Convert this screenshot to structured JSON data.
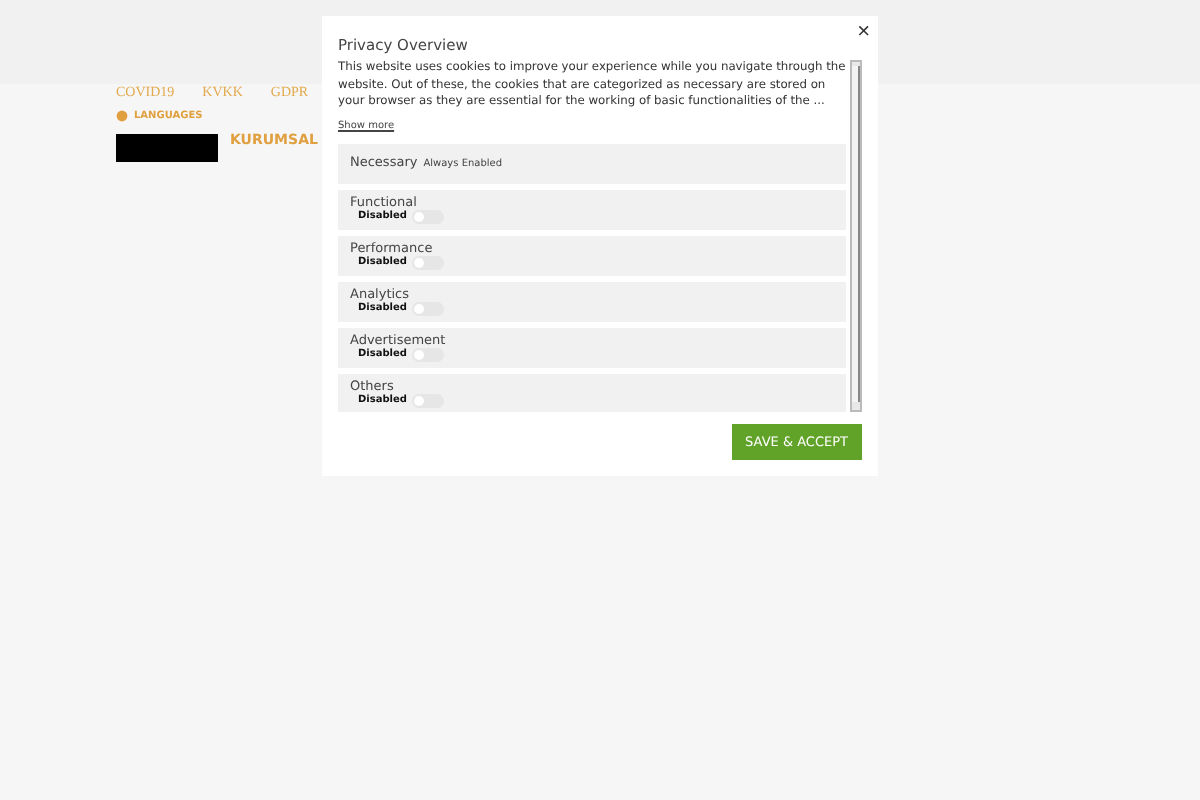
{
  "nav": {
    "links": [
      "COVID19",
      "KVKK",
      "GDPR"
    ],
    "languages": "LANGUAGES",
    "corporate": "KURUMSAL"
  },
  "modal": {
    "title": "Privacy Overview",
    "body": "This website uses cookies to improve your experience while you navigate through the website. Out of these, the cookies that are categorized as necessary are stored on your browser as they are essential for the working of basic functionalities of the ...",
    "show_more": "Show more",
    "close": "×",
    "categories": [
      {
        "kind": "fixed",
        "label": "Necessary",
        "note": "Always Enabled"
      },
      {
        "kind": "toggle",
        "label": "Functional",
        "state_text": "Disabled",
        "on": false
      },
      {
        "kind": "toggle",
        "label": "Performance",
        "state_text": "Disabled",
        "on": false
      },
      {
        "kind": "toggle",
        "label": "Analytics",
        "state_text": "Disabled",
        "on": false
      },
      {
        "kind": "toggle",
        "label": "Advertisement",
        "state_text": "Disabled",
        "on": false
      },
      {
        "kind": "toggle",
        "label": "Others",
        "state_text": "Disabled",
        "on": false
      }
    ],
    "save_button": "SAVE & ACCEPT"
  }
}
